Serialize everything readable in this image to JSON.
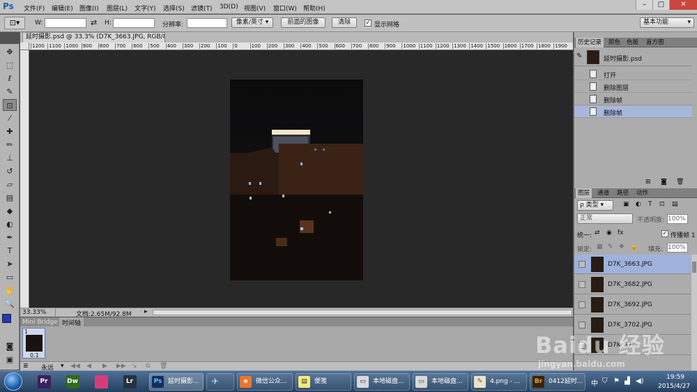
{
  "app": {
    "logo": "Ps",
    "workspace": "基本功能"
  },
  "menu": [
    "文件(F)",
    "编辑(E)",
    "图像(I)",
    "图层(L)",
    "文字(Y)",
    "选择(S)",
    "滤镜(T)",
    "3D(D)",
    "视图(V)",
    "窗口(W)",
    "帮助(H)"
  ],
  "window_controls": {
    "minimize": "–",
    "maximize": "□",
    "close": "✕"
  },
  "options_bar": {
    "w_label": "W:",
    "h_label": "H:",
    "swap_icon": "⇄",
    "resolution_label": "分辨率:",
    "unit_value": "像素/英寸",
    "front_image_button": "前面的图像",
    "clear_button": "清除",
    "show_grid_label": "显示网格",
    "show_grid_checked": true
  },
  "document": {
    "tab_title": "延时摄影.psd @ 33.3% (D7K_3663.JPG, RGB/8) *",
    "tab_close": "×"
  },
  "ruler": {
    "labels": [
      "1200",
      "1100",
      "1000",
      "900",
      "800",
      "700",
      "600",
      "500",
      "400",
      "300",
      "200",
      "100",
      "0",
      "100",
      "200",
      "300",
      "400",
      "500",
      "600",
      "700",
      "800",
      "900",
      "1000",
      "1100",
      "1200",
      "1300",
      "1400",
      "1500",
      "1600",
      "1700",
      "1800",
      "1900"
    ]
  },
  "status": {
    "zoom": "33.33%",
    "doc_info": "文档:2.65M/92.8M"
  },
  "bottom_panel": {
    "tabs": [
      "Mini Bridge",
      "时间轴"
    ],
    "frame_number": "1",
    "frame_delay": "0.1",
    "loop_value": "永远"
  },
  "tools": [
    "move-tool-icon",
    "marquee-tool-icon",
    "lasso-tool-icon",
    "quick-select-tool-icon",
    "crop-tool-icon",
    "eyedropper-tool-icon",
    "healing-brush-icon",
    "brush-tool-icon",
    "clone-stamp-icon",
    "history-brush-icon",
    "eraser-tool-icon",
    "gradient-tool-icon",
    "blur-tool-icon",
    "dodge-tool-icon",
    "pen-tool-icon",
    "type-tool-icon",
    "path-select-icon",
    "shape-tool-icon",
    "hand-tool-icon",
    "zoom-tool-icon"
  ],
  "colors": {
    "foreground": "#1f3bbd",
    "background": "#ffffff",
    "selection": "#a7b8db"
  },
  "history_panel": {
    "tabs": [
      "历史记录",
      "颜色",
      "色板",
      "直方图"
    ],
    "snapshot": "延时摄影.psd",
    "items": [
      "打开",
      "删除图层",
      "删除帧",
      "删除帧"
    ],
    "selected_index": 3
  },
  "layers_panel": {
    "tabs": [
      "图层",
      "通道",
      "路径",
      "动作"
    ],
    "filter_label": "ρ 类型",
    "blend_mode": "正常",
    "opacity_label": "不透明度:",
    "opacity_value": "100%",
    "unify_label": "统一:",
    "propagate_label": "传播帧 1",
    "lock_label": "锁定:",
    "fill_label": "填充:",
    "fill_value": "100%",
    "layers": [
      "D7K_3663.JPG",
      "D7K_3682.JPG",
      "D7K_3692.JPG",
      "D7K_3702.JPG",
      "D7K_37..."
    ],
    "selected_index": 0
  },
  "taskbar": {
    "pinned": [
      {
        "label": "Pr",
        "color": "#3b1f5e"
      },
      {
        "label": "Dw",
        "color": "#2f6b1a"
      },
      {
        "label": "",
        "color": "#d93b7a"
      },
      {
        "label": "Lr",
        "color": "#26313f"
      }
    ],
    "tasks": [
      "延时摄影...",
      "",
      "微信公众...",
      "便笺",
      "本地磁盘...",
      "本地磁盘...",
      "4.png - ...",
      "0412延时..."
    ],
    "tray_input": "中",
    "clock_time": "19:59",
    "clock_date": "2015/4/27"
  },
  "watermark": {
    "logo": "Baidu 经验",
    "url": "jingyan.baidu.com"
  }
}
